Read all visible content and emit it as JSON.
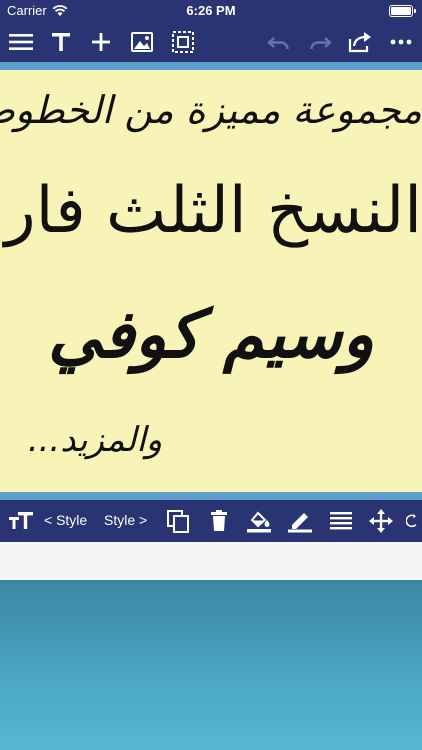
{
  "status_bar": {
    "carrier": "Carrier",
    "time": "6:26 PM",
    "wifi_icon": "wifi-icon",
    "battery_icon": "battery-icon"
  },
  "toolbar": {
    "icons": [
      "menu-icon",
      "text-icon",
      "plus-icon",
      "image-icon",
      "select-frame-icon",
      "undo-icon",
      "redo-icon",
      "share-icon",
      "more-icon"
    ],
    "undo_enabled": false,
    "redo_enabled": false
  },
  "canvas": {
    "background": "#f8f4b8",
    "border_color": "#5f9fd0",
    "lines": [
      "مجموعة مميزة من الخطوط",
      "النسخ الثلث فارسي",
      "وسيم كوفي",
      "والمزيد..."
    ]
  },
  "style_bar": {
    "prev_label": "< Style",
    "next_label": "Style >",
    "icons": [
      "font-size-icon",
      "copy-icon",
      "trash-icon",
      "fill-color-icon",
      "stroke-color-icon",
      "align-icon",
      "move-icon",
      "rotate-icon"
    ]
  },
  "colors": {
    "bar": "#2a3472",
    "canvas": "#f8f4b8",
    "gradient_top": "#3c86a3",
    "gradient_bottom": "#56b9d1"
  }
}
